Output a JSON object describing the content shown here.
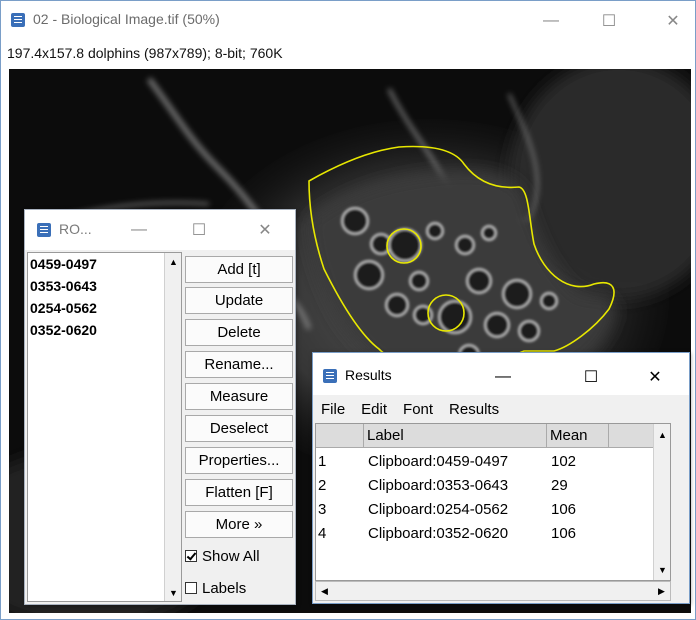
{
  "main_window": {
    "title": "02 - Biological Image.tif (50%)",
    "info": "197.4x157.8 dolphins (987x789); 8-bit; 760K",
    "controls": {
      "minimize": "—",
      "maximize": "☐",
      "close": "✕"
    }
  },
  "roi_manager": {
    "title": "RO...",
    "controls": {
      "minimize": "—",
      "maximize": "☐",
      "close": "✕"
    },
    "items": [
      "0459-0497",
      "0353-0643",
      "0254-0562",
      "0352-0620"
    ],
    "buttons": [
      "Add [t]",
      "Update",
      "Delete",
      "Rename...",
      "Measure",
      "Deselect",
      "Properties...",
      "Flatten [F]",
      "More »"
    ],
    "show_all": {
      "label": "Show All",
      "checked": true
    },
    "labels": {
      "label": "Labels",
      "checked": false
    }
  },
  "results": {
    "title": "Results",
    "controls": {
      "minimize": "—",
      "maximize": "☐",
      "close": "✕"
    },
    "menu": [
      "File",
      "Edit",
      "Font",
      "Results"
    ],
    "columns": [
      "",
      "Label",
      "Mean",
      ""
    ],
    "rows": [
      {
        "index": "1",
        "label": "Clipboard:0459-0497",
        "mean": "102"
      },
      {
        "index": "2",
        "label": "Clipboard:0353-0643",
        "mean": "29"
      },
      {
        "index": "3",
        "label": "Clipboard:0254-0562",
        "mean": "106"
      },
      {
        "index": "4",
        "label": "Clipboard:0352-0620",
        "mean": "106"
      }
    ]
  },
  "colors": {
    "roi_outline": "#e8e800",
    "accent": "#3a6fb8"
  }
}
